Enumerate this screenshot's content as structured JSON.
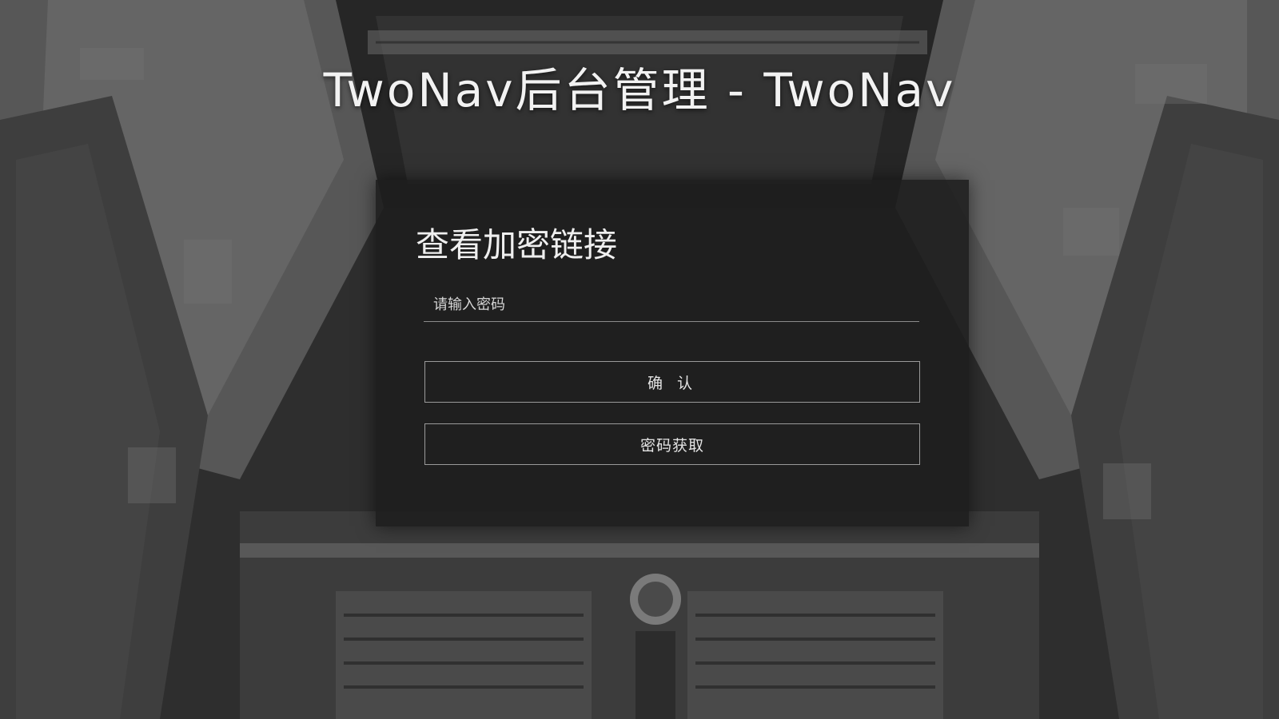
{
  "page": {
    "title": "TwoNav后台管理 - TwoNav"
  },
  "panel": {
    "heading": "查看加密链接",
    "password_placeholder": "请输入密码",
    "confirm_label": "确 认",
    "get_password_label": "密码获取"
  },
  "colors": {
    "background": "#303030",
    "panel_background": "#1e1e1e",
    "text": "#f2f2f2",
    "border": "#9a9a9a"
  }
}
